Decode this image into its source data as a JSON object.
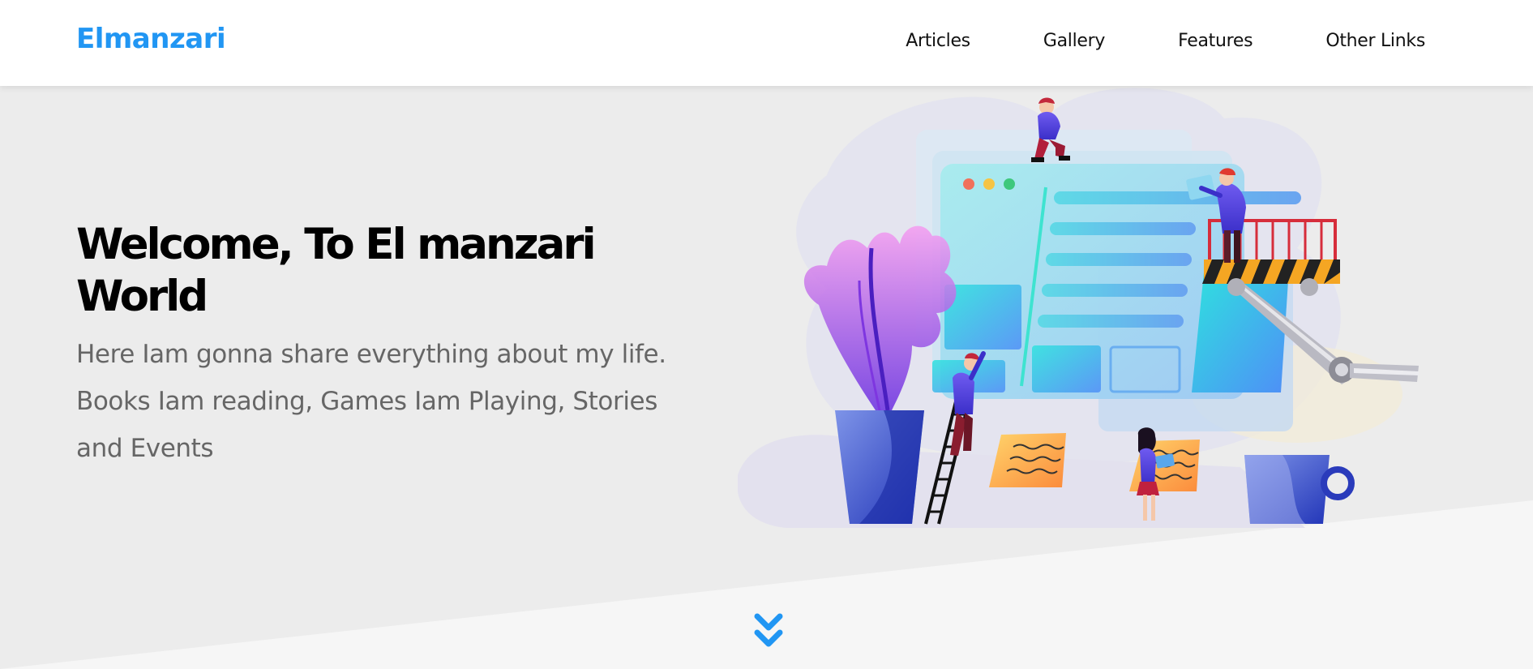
{
  "header": {
    "logo": "Elmanzari",
    "nav": [
      {
        "label": "Articles"
      },
      {
        "label": "Gallery"
      },
      {
        "label": "Features"
      },
      {
        "label": "Other Links"
      }
    ]
  },
  "hero": {
    "title": "Welcome, To El manzari World",
    "description": "Here Iam gonna share everything about my life. Books Iam reading, Games Iam Playing, Stories and Events"
  },
  "icons": {
    "scroll_down": "double-chevron-down-icon",
    "illustration": "web-design-team-illustration"
  },
  "colors": {
    "brand": "#2196f3",
    "landing_bg": "#ececec",
    "page_bg": "#f6f6f6",
    "title": "#000000",
    "text": "#666666"
  }
}
